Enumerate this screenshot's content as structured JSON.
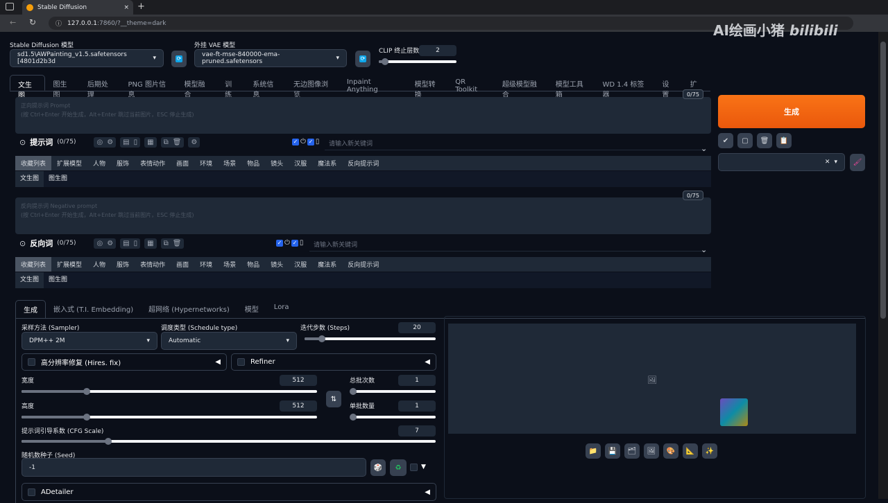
{
  "browser": {
    "tab_title": "Stable Diffusion",
    "url_host": "127.0.0.1",
    "url_rest": ":7860/?__theme=dark",
    "new_tab": "+",
    "close": "×"
  },
  "watermark": "AI绘画小猪 bilibili",
  "models": {
    "sd_label": "Stable Diffusion 模型",
    "sd_value": "sd1.5\\AWPainting_v1.5.safetensors [4801d2b3d",
    "vae_label": "外挂 VAE 模型",
    "vae_value": "vae-ft-mse-840000-ema-pruned.safetensors",
    "clip_label": "CLIP 终止层数",
    "clip_value": "2",
    "clip_fraction": 0.08
  },
  "main_tabs": [
    "文生图",
    "图生图",
    "后期处理",
    "PNG 图片信息",
    "模型融合",
    "训练",
    "系统信息",
    "无边图像浏览",
    "Inpaint Anything",
    "模型转换",
    "QR Toolkit",
    "超级模型融合",
    "模型工具箱",
    "WD 1.4 标签器",
    "设置",
    "扩展"
  ],
  "prompt": {
    "placeholder1": "正向提示词 Prompt",
    "placeholder2": "(按 Ctrl+Enter 开始生成，Alt+Enter 跳过当前图片，ESC 停止生成)",
    "count": "0/75",
    "title": "提示词",
    "title_count": "(0/75)",
    "kw_placeholder": "请输入新关键词"
  },
  "negative": {
    "placeholder1": "反向提示词 Negative prompt",
    "placeholder2": "(按 Ctrl+Enter 开始生成，Alt+Enter 跳过当前图片，ESC 停止生成)",
    "count": "0/75",
    "title": "反向词",
    "title_count": "(0/75)",
    "kw_placeholder": "请输入新关键词"
  },
  "tag_categories": [
    "收藏列表",
    "扩展模型",
    "人物",
    "服饰",
    "表情动作",
    "画面",
    "环境",
    "场景",
    "物品",
    "镜头",
    "汉服",
    "魔法系",
    "反向提示词"
  ],
  "sub_tabs": [
    "文生图",
    "图生图"
  ],
  "generate": {
    "label": "生成"
  },
  "bottom_tabs": [
    "生成",
    "嵌入式 (T.I. Embedding)",
    "超网络 (Hypernetworks)",
    "模型",
    "Lora"
  ],
  "params": {
    "sampler_label": "采样方法 (Sampler)",
    "sampler_value": "DPM++ 2M",
    "schedule_label": "调度类型 (Schedule type)",
    "schedule_value": "Automatic",
    "steps_label": "迭代步数 (Steps)",
    "steps_value": "20",
    "steps_fraction": 0.13,
    "hires_label": "高分辨率修复 (Hires. fix)",
    "refiner_label": "Refiner",
    "width_label": "宽度",
    "width_value": "512",
    "width_fraction": 0.22,
    "height_label": "高度",
    "height_value": "512",
    "height_fraction": 0.22,
    "batch_count_label": "总批次数",
    "batch_count_value": "1",
    "batch_count_fraction": 0,
    "batch_size_label": "单批数量",
    "batch_size_value": "1",
    "batch_size_fraction": 0,
    "cfg_label": "提示词引导系数 (CFG Scale)",
    "cfg_value": "7",
    "cfg_fraction": 0.21,
    "seed_label": "随机数种子 (Seed)",
    "seed_value": "-1",
    "adetailer_label": "ADetailer"
  },
  "colors": {
    "accent": "#ea580c",
    "bg": "#0b0f19",
    "panel": "#1f2937"
  }
}
